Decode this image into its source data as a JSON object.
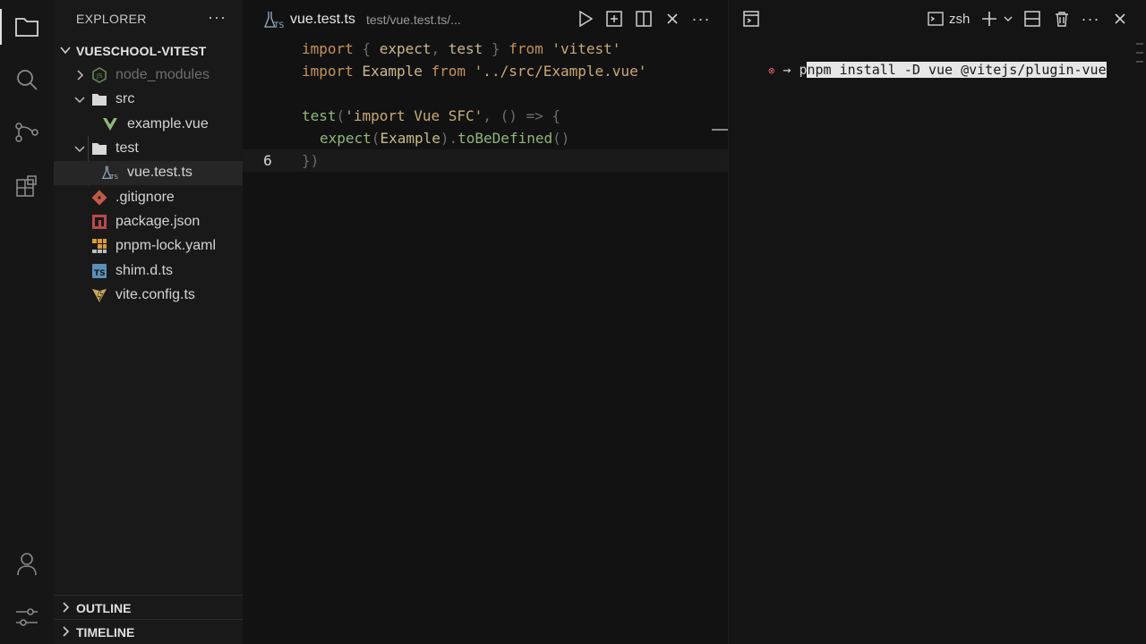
{
  "explorer": {
    "title": "EXPLORER",
    "more": "···",
    "root": "VUESCHOOL-VITEST",
    "items": [
      {
        "label": "node_modules",
        "icon": "node-folder-icon"
      },
      {
        "label": "src",
        "icon": "folder-icon"
      },
      {
        "label": "example.vue",
        "icon": "vue-icon"
      },
      {
        "label": "test",
        "icon": "folder-icon"
      },
      {
        "label": "vue.test.ts",
        "icon": "test-flask-icon"
      },
      {
        "label": ".gitignore",
        "icon": "git-icon"
      },
      {
        "label": "package.json",
        "icon": "npm-icon"
      },
      {
        "label": "pnpm-lock.yaml",
        "icon": "pnpm-icon"
      },
      {
        "label": "shim.d.ts",
        "icon": "ts-icon"
      },
      {
        "label": "vite.config.ts",
        "icon": "vite-icon"
      }
    ],
    "sections": [
      "OUTLINE",
      "TIMELINE"
    ]
  },
  "editor": {
    "tab_name": "vue.test.ts",
    "tab_path": "test/vue.test.ts/...",
    "current_line_number": "6",
    "lines": [
      {
        "kw1": "import",
        "p1": " { ",
        "id1": "expect",
        "p2": ", ",
        "id2": "test",
        "p3": " } ",
        "kw2": "from",
        "sp": " ",
        "str": "'vitest'"
      },
      {
        "kw1": "import",
        "id1": " Example ",
        "kw2": "from",
        "sp": " ",
        "str": "'../src/Example.vue'"
      },
      {
        "fn": "test",
        "p1": "(",
        "str": "'import Vue SFC'",
        "p2": ", () => {"
      },
      {
        "fn1": "expect",
        "p1": "(",
        "id": "Example",
        "p2": ").",
        "fn2": "toBeDefined",
        "p3": "()"
      },
      {
        "text": "})"
      }
    ]
  },
  "terminal": {
    "shell": "zsh",
    "command_first_char": "p",
    "command_rest": "npm install -D vue @vitejs/plugin-vue",
    "prompt_symbol": "→",
    "status_symbol": "⊗"
  }
}
